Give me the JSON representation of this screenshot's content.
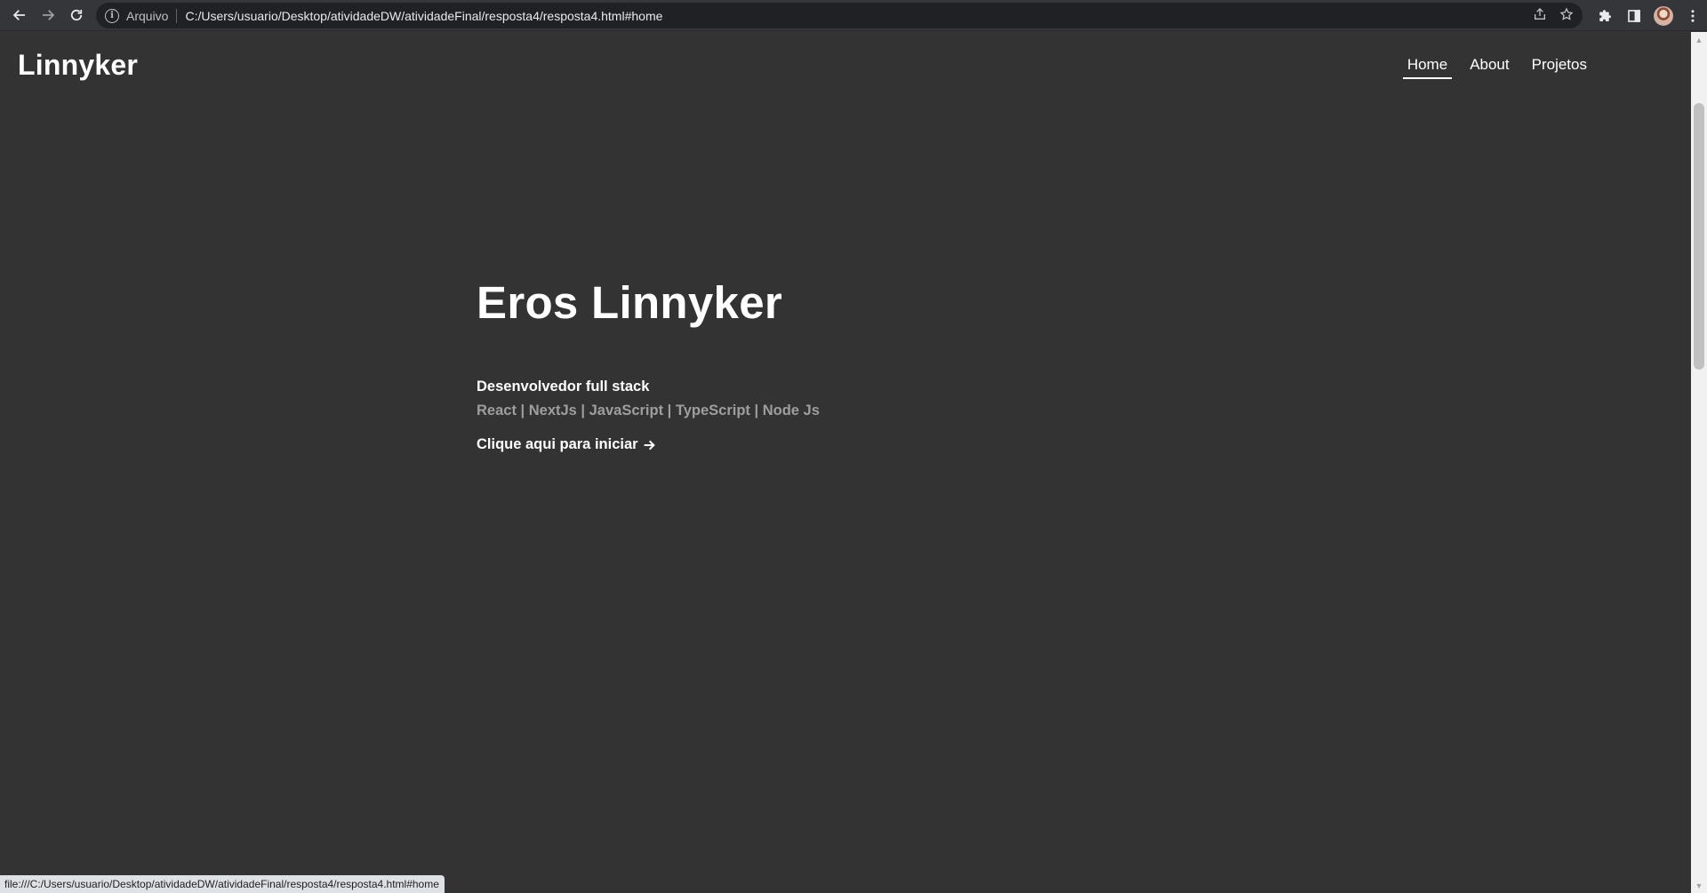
{
  "browser": {
    "scheme_label": "Arquivo",
    "url": "C:/Users/usuario/Desktop/atividadeDW/atividadeFinal/resposta4/resposta4.html#home",
    "status_url": "file:///C:/Users/usuario/Desktop/atividadeDW/atividadeFinal/resposta4/resposta4.html#home"
  },
  "site": {
    "logo": "Linnyker",
    "nav": [
      {
        "label": "Home",
        "active": true
      },
      {
        "label": "About",
        "active": false
      },
      {
        "label": "Projetos",
        "active": false
      }
    ]
  },
  "hero": {
    "title": "Eros Linnyker",
    "role": "Desenvolvedor full stack",
    "stack": "React | NextJs | JavaScript | TypeScript | Node Js",
    "cta_label": "Clique aqui para iniciar"
  },
  "colors": {
    "page_background": "#333333",
    "text_primary": "#ffffff",
    "text_muted": "#9e9e9e",
    "browser_toolbar": "#35363a"
  }
}
